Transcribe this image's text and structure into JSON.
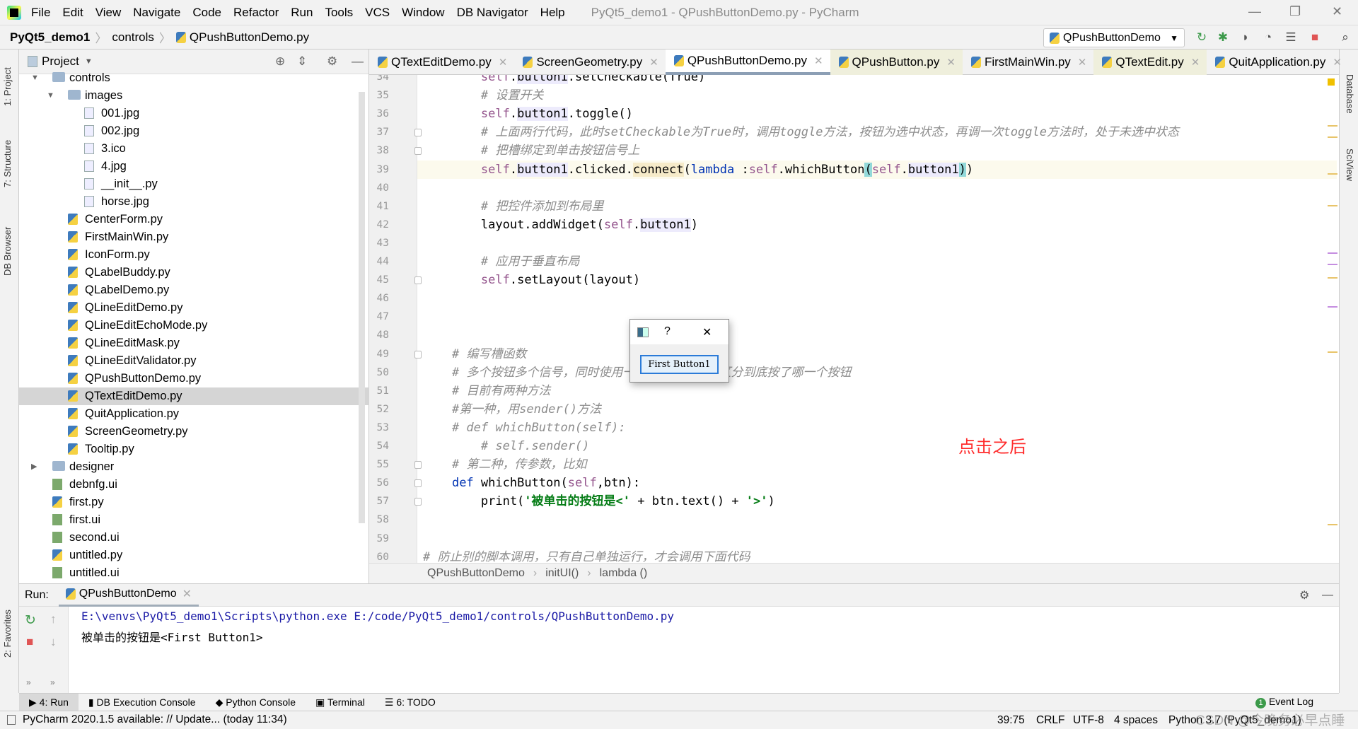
{
  "window": {
    "title": "PyQt5_demo1 - QPushButtonDemo.py - PyCharm"
  },
  "menu": [
    "File",
    "Edit",
    "View",
    "Navigate",
    "Code",
    "Refactor",
    "Run",
    "Tools",
    "VCS",
    "Window",
    "DB Navigator",
    "Help"
  ],
  "breadcrumb": [
    "PyQt5_demo1",
    "controls",
    "QPushButtonDemo.py"
  ],
  "run_config": "QPushButtonDemo",
  "left_strip": [
    "1: Project",
    "7: Structure",
    "DB Browser",
    "2: Favorites"
  ],
  "right_strip": [
    "Database",
    "SciView"
  ],
  "project": {
    "title": "Project",
    "tree": [
      {
        "name": "controls",
        "level": 0,
        "type": "folder",
        "open": true
      },
      {
        "name": "images",
        "level": 1,
        "type": "folder",
        "open": true
      },
      {
        "name": "001.jpg",
        "level": 2,
        "type": "file"
      },
      {
        "name": "002.jpg",
        "level": 2,
        "type": "file"
      },
      {
        "name": "3.ico",
        "level": 2,
        "type": "file"
      },
      {
        "name": "4.jpg",
        "level": 2,
        "type": "file"
      },
      {
        "name": "__init__.py",
        "level": 2,
        "type": "file"
      },
      {
        "name": "horse.jpg",
        "level": 2,
        "type": "file"
      },
      {
        "name": "CenterForm.py",
        "level": 1,
        "type": "py"
      },
      {
        "name": "FirstMainWin.py",
        "level": 1,
        "type": "py"
      },
      {
        "name": "IconForm.py",
        "level": 1,
        "type": "py"
      },
      {
        "name": "QLabelBuddy.py",
        "level": 1,
        "type": "py"
      },
      {
        "name": "QLabelDemo.py",
        "level": 1,
        "type": "py"
      },
      {
        "name": "QLineEditDemo.py",
        "level": 1,
        "type": "py"
      },
      {
        "name": "QLineEditEchoMode.py",
        "level": 1,
        "type": "py"
      },
      {
        "name": "QLineEditMask.py",
        "level": 1,
        "type": "py"
      },
      {
        "name": "QLineEditValidator.py",
        "level": 1,
        "type": "py"
      },
      {
        "name": "QPushButtonDemo.py",
        "level": 1,
        "type": "py"
      },
      {
        "name": "QTextEditDemo.py",
        "level": 1,
        "type": "py",
        "selected": true
      },
      {
        "name": "QuitApplication.py",
        "level": 1,
        "type": "py"
      },
      {
        "name": "ScreenGeometry.py",
        "level": 1,
        "type": "py"
      },
      {
        "name": "Tooltip.py",
        "level": 1,
        "type": "py"
      },
      {
        "name": "designer",
        "level": 0,
        "type": "folder",
        "open": false
      },
      {
        "name": "debnfg.ui",
        "level": 0,
        "type": "ui"
      },
      {
        "name": "first.py",
        "level": 0,
        "type": "py"
      },
      {
        "name": "first.ui",
        "level": 0,
        "type": "ui"
      },
      {
        "name": "second.ui",
        "level": 0,
        "type": "ui"
      },
      {
        "name": "untitled.py",
        "level": 0,
        "type": "py"
      },
      {
        "name": "untitled.ui",
        "level": 0,
        "type": "ui"
      }
    ]
  },
  "tabs": [
    {
      "label": "QTextEditDemo.py"
    },
    {
      "label": "ScreenGeometry.py"
    },
    {
      "label": "QPushButtonDemo.py",
      "active": true
    },
    {
      "label": "QPushButton.py",
      "modified": true
    },
    {
      "label": "FirstMainWin.py"
    },
    {
      "label": "QTextEdit.py",
      "modified": true
    },
    {
      "label": "QuitApplication.py"
    }
  ],
  "editor": {
    "current_line": 39,
    "lines": [
      {
        "n": 34,
        "tokens": [
          [
            "        ",
            ""
          ],
          [
            "self",
            "self"
          ],
          [
            ".",
            ""
          ],
          [
            "button1",
            "hl"
          ],
          [
            ".setCheckable(True)",
            ""
          ]
        ]
      },
      {
        "n": 35,
        "tokens": [
          [
            "        # 设置开关",
            "cm"
          ]
        ]
      },
      {
        "n": 36,
        "tokens": [
          [
            "        ",
            ""
          ],
          [
            "self",
            "self"
          ],
          [
            ".",
            ""
          ],
          [
            "button1",
            "hl"
          ],
          [
            ".toggle()",
            ""
          ]
        ]
      },
      {
        "n": 37,
        "tokens": [
          [
            "        # 上面两行代码，此时setCheckable为True时，调用toggle方法，按钮为选中状态，再调一次toggle方法时，处于未选中状态",
            "cm"
          ]
        ]
      },
      {
        "n": 38,
        "tokens": [
          [
            "        # 把槽绑定到单击按钮信号上",
            "cm"
          ]
        ]
      },
      {
        "n": 39,
        "tokens": [
          [
            "        ",
            ""
          ],
          [
            "self",
            "self"
          ],
          [
            ".",
            ""
          ],
          [
            "button1",
            "hl"
          ],
          [
            ".clicked.",
            ""
          ],
          [
            "connect",
            "con"
          ],
          [
            "(",
            ""
          ],
          [
            "lambda",
            "kw"
          ],
          [
            " :",
            ""
          ],
          [
            "self",
            "self"
          ],
          [
            ".whichButton",
            ""
          ],
          [
            "(",
            "br"
          ],
          [
            "self",
            "self"
          ],
          [
            ".",
            ""
          ],
          [
            "button1",
            "hl"
          ],
          [
            ")",
            "br"
          ],
          [
            ")",
            ""
          ]
        ]
      },
      {
        "n": 40,
        "tokens": []
      },
      {
        "n": 41,
        "tokens": [
          [
            "        # 把控件添加到布局里",
            "cm"
          ]
        ]
      },
      {
        "n": 42,
        "tokens": [
          [
            "        layout.addWidget(",
            ""
          ],
          [
            "self",
            "self"
          ],
          [
            ".",
            ""
          ],
          [
            "button1",
            "hl"
          ],
          [
            ")",
            ""
          ]
        ]
      },
      {
        "n": 43,
        "tokens": []
      },
      {
        "n": 44,
        "tokens": [
          [
            "        # 应用于垂直布局",
            "cm"
          ]
        ]
      },
      {
        "n": 45,
        "tokens": [
          [
            "        ",
            ""
          ],
          [
            "self",
            "self"
          ],
          [
            ".setLayout(layout)",
            ""
          ]
        ]
      },
      {
        "n": 46,
        "tokens": []
      },
      {
        "n": 47,
        "tokens": []
      },
      {
        "n": 48,
        "tokens": []
      },
      {
        "n": 49,
        "tokens": [
          [
            "    # 编写槽函数",
            "cm"
          ]
        ]
      },
      {
        "n": 50,
        "tokens": [
          [
            "    # 多个按钮多个信号，同时使用一个槽函数，需要区分到底按了哪一个按钮",
            "cm"
          ]
        ]
      },
      {
        "n": 51,
        "tokens": [
          [
            "    # 目前有两种方法",
            "cm"
          ]
        ]
      },
      {
        "n": 52,
        "tokens": [
          [
            "    #第一种，用sender()方法",
            "cm"
          ]
        ]
      },
      {
        "n": 53,
        "tokens": [
          [
            "    # def whichButton(self):",
            "cm"
          ]
        ]
      },
      {
        "n": 54,
        "tokens": [
          [
            "        # self.sender()",
            "cm"
          ]
        ]
      },
      {
        "n": 55,
        "tokens": [
          [
            "    # 第二种，传参数，比如",
            "cm"
          ]
        ]
      },
      {
        "n": 56,
        "tokens": [
          [
            "    ",
            ""
          ],
          [
            "def",
            "kw"
          ],
          [
            " whichButton(",
            ""
          ],
          [
            "self",
            "self"
          ],
          [
            ",btn):",
            ""
          ]
        ]
      },
      {
        "n": 57,
        "tokens": [
          [
            "        print(",
            ""
          ],
          [
            "'被单击的按钮是<'",
            "str"
          ],
          [
            " + btn.text() + ",
            ""
          ],
          [
            "'>'",
            "str"
          ],
          [
            ")",
            ""
          ]
        ]
      },
      {
        "n": 58,
        "tokens": []
      },
      {
        "n": 59,
        "tokens": []
      },
      {
        "n": 60,
        "tokens": [
          [
            "# 防止别的脚本调用，只有自己单独运行，才会调用下面代码",
            "cm"
          ]
        ]
      }
    ]
  },
  "editor_breadcrumb": [
    "QPushButtonDemo",
    "initUI()",
    "lambda ()"
  ],
  "dialog": {
    "help": "?",
    "close": "✕",
    "button_label": "First Button1"
  },
  "annotation": "点击之后",
  "run": {
    "label": "Run:",
    "tab": "QPushButtonDemo",
    "output": [
      "E:\\venvs\\PyQt5_demo1\\Scripts\\python.exe E:/code/PyQt5_demo1/controls/QPushButtonDemo.py",
      "被单击的按钮是<First Button1>"
    ]
  },
  "bottom_tabs": [
    "4: Run",
    "DB Execution Console",
    "Python Console",
    "Terminal",
    "6: TODO"
  ],
  "event_log": {
    "count": "1",
    "label": "Event Log"
  },
  "status": {
    "message": "PyCharm 2020.1.5 available: // Update... (today 11:34)",
    "position": "39:75",
    "line_ending": "CRLF",
    "encoding": "UTF-8",
    "indent": "4 spaces",
    "interpreter": "Python 3.7 (PyQt5_demo1)"
  },
  "watermark": "CSDN @今晚务必早点睡",
  "colors": {
    "accent": "#2b7bd8",
    "annotation": "#ff2b2b",
    "stop": "#e05555",
    "run": "#3c9a4a"
  }
}
